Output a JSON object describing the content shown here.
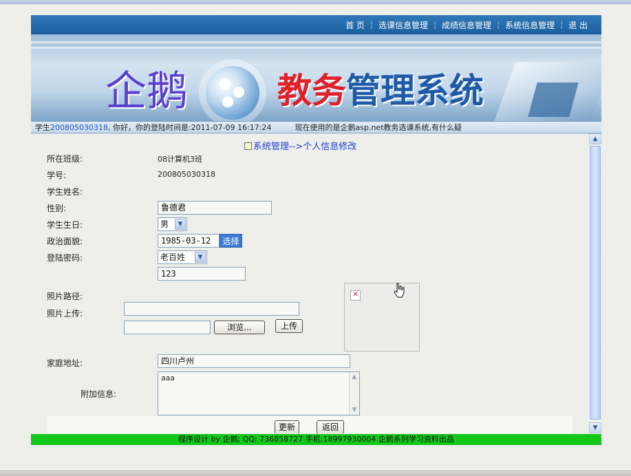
{
  "nav": {
    "items": [
      "首 页",
      "选课信息管理",
      "成绩信息管理",
      "系统信息管理",
      "退 出"
    ]
  },
  "banner": {
    "logo_part1": "企鹅",
    "logo_part2_red": "教务",
    "logo_part2_blue": "管理系统"
  },
  "status": {
    "prefix": "学生",
    "student_id": "200805030318",
    "greeting": ", 你好，你的登陆时间是:2011-07-09 16:17:24",
    "notice": "现在使用的是企鹅asp.net教务选课系统,有什么疑"
  },
  "breadcrumb": {
    "text": "系统管理-->个人信息修改"
  },
  "form": {
    "class_label": "所在班级:",
    "class_value": "08计算机3班",
    "id_label": "学号:",
    "id_value": "200805030318",
    "name_label": "学生姓名:",
    "name_value": "鲁德君",
    "gender_label": "性别:",
    "gender_value": "男",
    "birthday_label": "学生生日:",
    "birthday_value": "1985-03-12",
    "pick_label": "选择",
    "politics_label": "政治面貌:",
    "politics_value": "老百姓",
    "password_label": "登陆密码:",
    "password_value": "123",
    "photo_path_label": "照片路径:",
    "photo_path_value": "",
    "photo_upload_label": "照片上传:",
    "photo_upload_value": "",
    "browse_label": "浏览...",
    "upload_label": "上传",
    "address_label": "家庭地址:",
    "address_value": "四川卢州",
    "extra_label": "附加信息:",
    "extra_value": "aaa",
    "update_label": "更新",
    "back_label": "返回"
  },
  "footer": {
    "text": "程序设计 by 企鹅; QQ: 736858727 手机:18997930004 企鹅系列学习资料出品"
  },
  "colors": {
    "nav_bg": "#1b5f9e",
    "footer_bg": "#13c81a",
    "breadcrumb": "#1a3fd8",
    "link": "#1a56c4"
  }
}
